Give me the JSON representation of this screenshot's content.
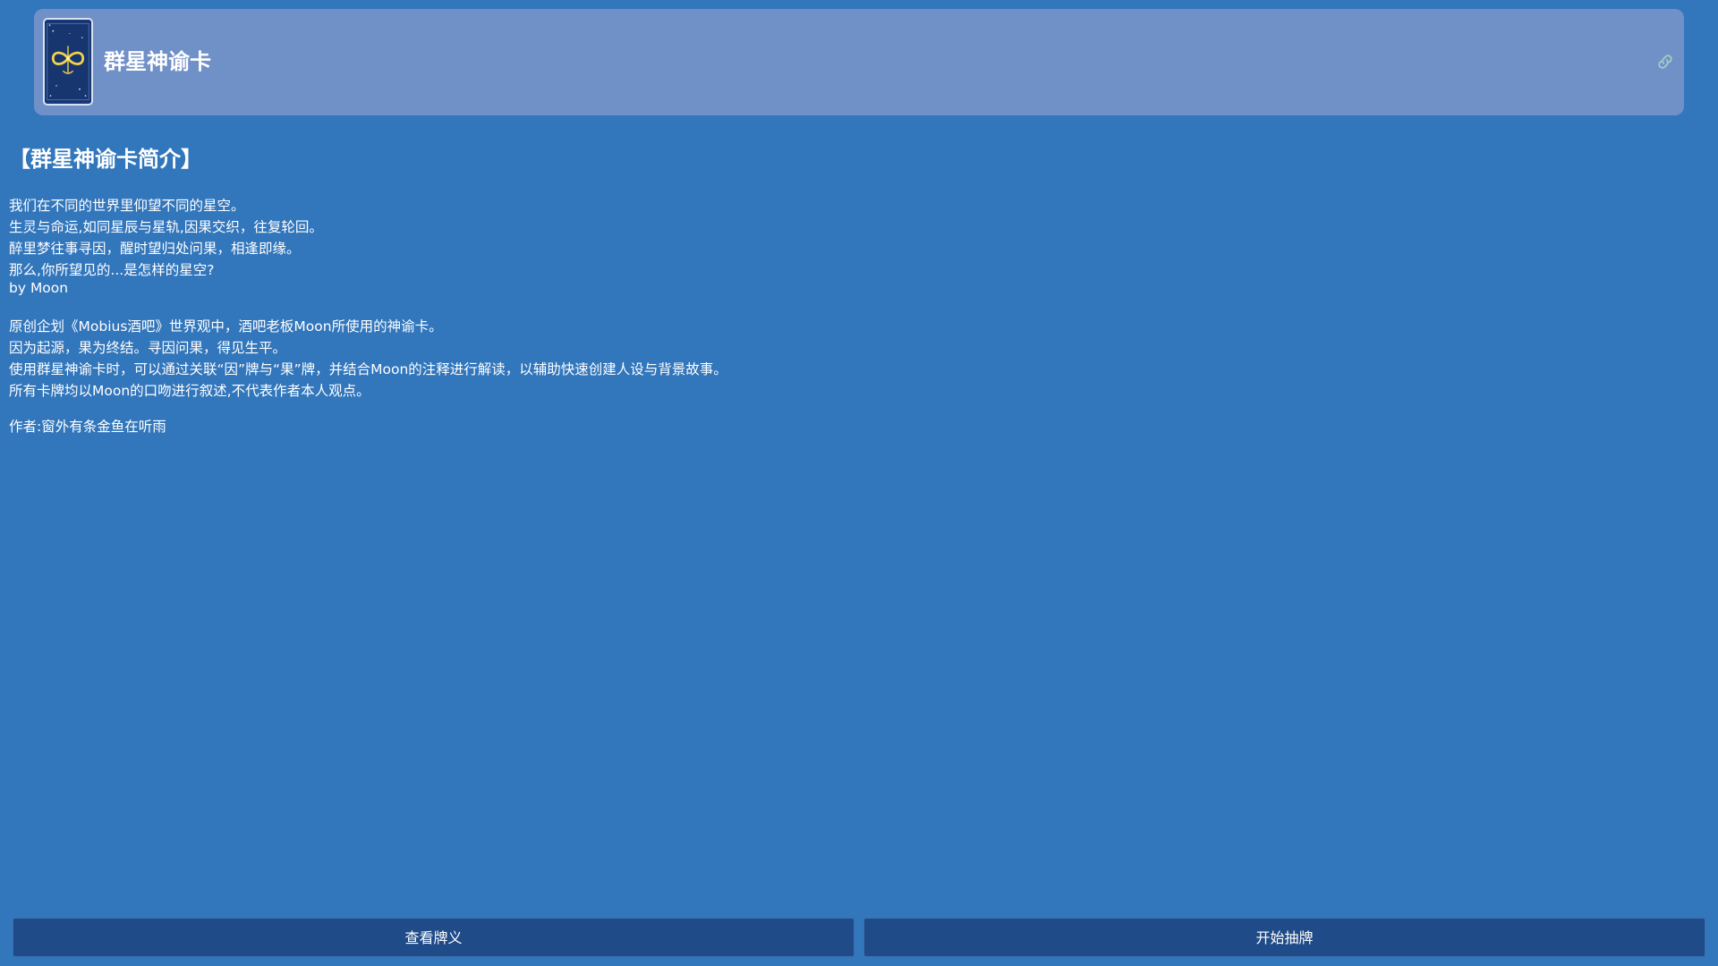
{
  "header": {
    "title": "群星神谕卡",
    "card_icon": "infinity-card-icon",
    "link_icon": "link-icon"
  },
  "intro": {
    "heading": "【群星神谕卡简介】",
    "poem": [
      "我们在不同的世界里仰望不同的星空。",
      "生灵与命运,如同星辰与星轨,因果交织，往复轮回。",
      "醉里梦往事寻因，醒时望归处问果，相逢即缘。",
      "那么,你所望见的...是怎样的星空?"
    ],
    "byline": "by Moon",
    "description": [
      "原创企划《Mobius酒吧》世界观中，酒吧老板Moon所使用的神谕卡。",
      "因为起源，果为终结。寻因问果，得见生平。",
      "使用群星神谕卡时，可以通过关联“因”牌与“果”牌，并结合Moon的注释进行解读，以辅助快速创建人设与背景故事。",
      "所有卡牌均以Moon的口吻进行叙述,不代表作者本人观点。"
    ],
    "author": "作者:窗外有条金鱼在听雨"
  },
  "buttons": {
    "view_meanings": "查看牌义",
    "start_draw": "开始抽牌"
  },
  "colors": {
    "background": "#3276bc",
    "header_bg": "#7090c8",
    "button_bg": "#1f4b88",
    "card_gold": "#f2d24a"
  }
}
